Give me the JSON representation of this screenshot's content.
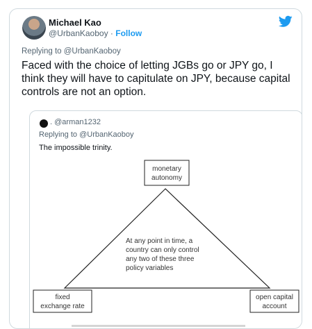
{
  "author": {
    "name": "Michael Kao",
    "handle": "@UrbanKaoboy",
    "separator": " · ",
    "follow_label": "Follow"
  },
  "reply_to": "Replying to @UrbanKaoboy",
  "tweet_text": "Faced with the choice of letting JGBs go or JPY go, I think they will have to capitulate on JPY, because capital controls are not an option.",
  "quoted": {
    "handle": "@arman1232",
    "handle_prefix": ". ",
    "reply_to": "Replying to @UrbanKaoboy",
    "text": "The impossible trinity.",
    "diagram": {
      "top_box": [
        "monetary",
        "autonomy"
      ],
      "left_box": [
        "fixed",
        "exchange rate"
      ],
      "right_box": [
        "open capital",
        "account"
      ],
      "center_text": [
        "At any point in time, a",
        "country can only control",
        "any two of these three",
        "policy variables"
      ]
    }
  },
  "icons": {
    "brand": "twitter-bird-icon",
    "author_avatar": "author-avatar",
    "quoted_avatar": "black-circle-avatar"
  },
  "colors": {
    "brand_blue": "#1d9bf0",
    "secondary_text": "#536471",
    "primary_text": "#0f1419",
    "border": "#cfd9de"
  }
}
